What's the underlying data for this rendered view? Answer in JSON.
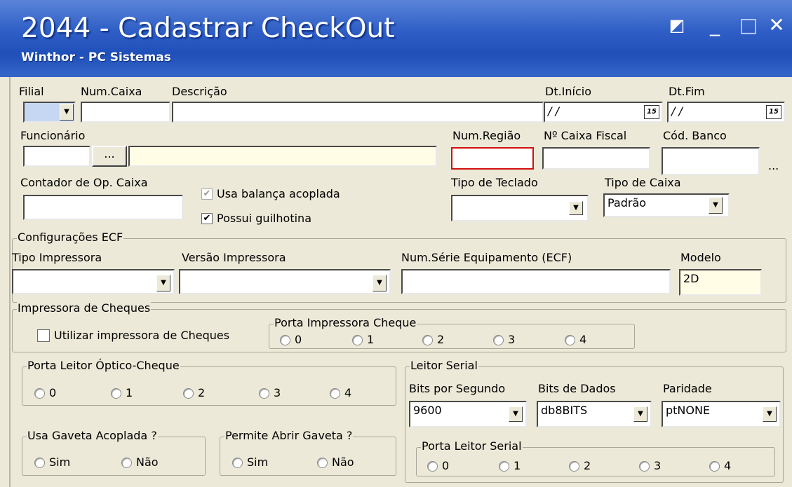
{
  "window": {
    "title": "2044 - Cadastrar CheckOut",
    "subtitle": "Winthor - PC Sistemas",
    "buttons": {
      "restore": "◩",
      "minimize": "_",
      "maximize": "□",
      "close": "✕"
    }
  },
  "row1": {
    "filial_label": "Filial",
    "num_caixa_label": "Num.Caixa",
    "descricao_label": "Descrição",
    "dt_inicio_label": "Dt.Início",
    "dt_inicio_value": " / /",
    "dt_fim_label": "Dt.Fim",
    "dt_fim_value": " / /",
    "calendar_icon": "15"
  },
  "row2": {
    "funcionario_label": "Funcionário",
    "lookup_button": "...",
    "num_regiao_label": "Num.Região",
    "caixa_fiscal_label": "Nº Caixa Fiscal",
    "cod_banco_label": "Cód. Banco",
    "cod_banco_more": "..."
  },
  "row3": {
    "contador_label": "Contador de Op. Caixa",
    "usa_balanca_label": "Usa balança acoplada",
    "usa_balanca_checked": true,
    "possui_guilhotina_label": "Possui guilhotina",
    "possui_guilhotina_checked": true,
    "tipo_teclado_label": "Tipo de Teclado",
    "tipo_caixa_label": "Tipo de Caixa",
    "tipo_caixa_value": "Padrão"
  },
  "ecf": {
    "group_label": "Configurações ECF",
    "tipo_impressora_label": "Tipo Impressora",
    "versao_impressora_label": "Versão Impressora",
    "num_serie_label": "Num.Série Equipamento (ECF)",
    "modelo_label": "Modelo",
    "modelo_value": "2D"
  },
  "cheques": {
    "group_label": "Impressora de Cheques",
    "utilizar_label": "Utilizar impressora de Cheques",
    "porta_group_label": "Porta Impressora Cheque",
    "porta_options": [
      "0",
      "1",
      "2",
      "3",
      "4"
    ]
  },
  "leitor_optico": {
    "group_label": "Porta Leitor Óptico-Cheque",
    "options": [
      "0",
      "1",
      "2",
      "3",
      "4"
    ]
  },
  "gaveta": {
    "usa_label": "Usa Gaveta Acoplada ?",
    "permite_label": "Permite Abrir Gaveta ?",
    "sim": "Sim",
    "nao": "Não"
  },
  "leitor_serial": {
    "group_label": "Leitor Serial",
    "bits_segundo_label": "Bits por Segundo",
    "bits_segundo_value": "9600",
    "bits_dados_label": "Bits de Dados",
    "bits_dados_value": "db8BITS",
    "paridade_label": "Paridade",
    "paridade_value": "ptNONE",
    "porta_group_label": "Porta Leitor Serial",
    "porta_options": [
      "0",
      "1",
      "2",
      "3",
      "4"
    ]
  },
  "icons": {
    "dropdown": "chevron-down-icon",
    "calendar": "calendar-icon"
  }
}
